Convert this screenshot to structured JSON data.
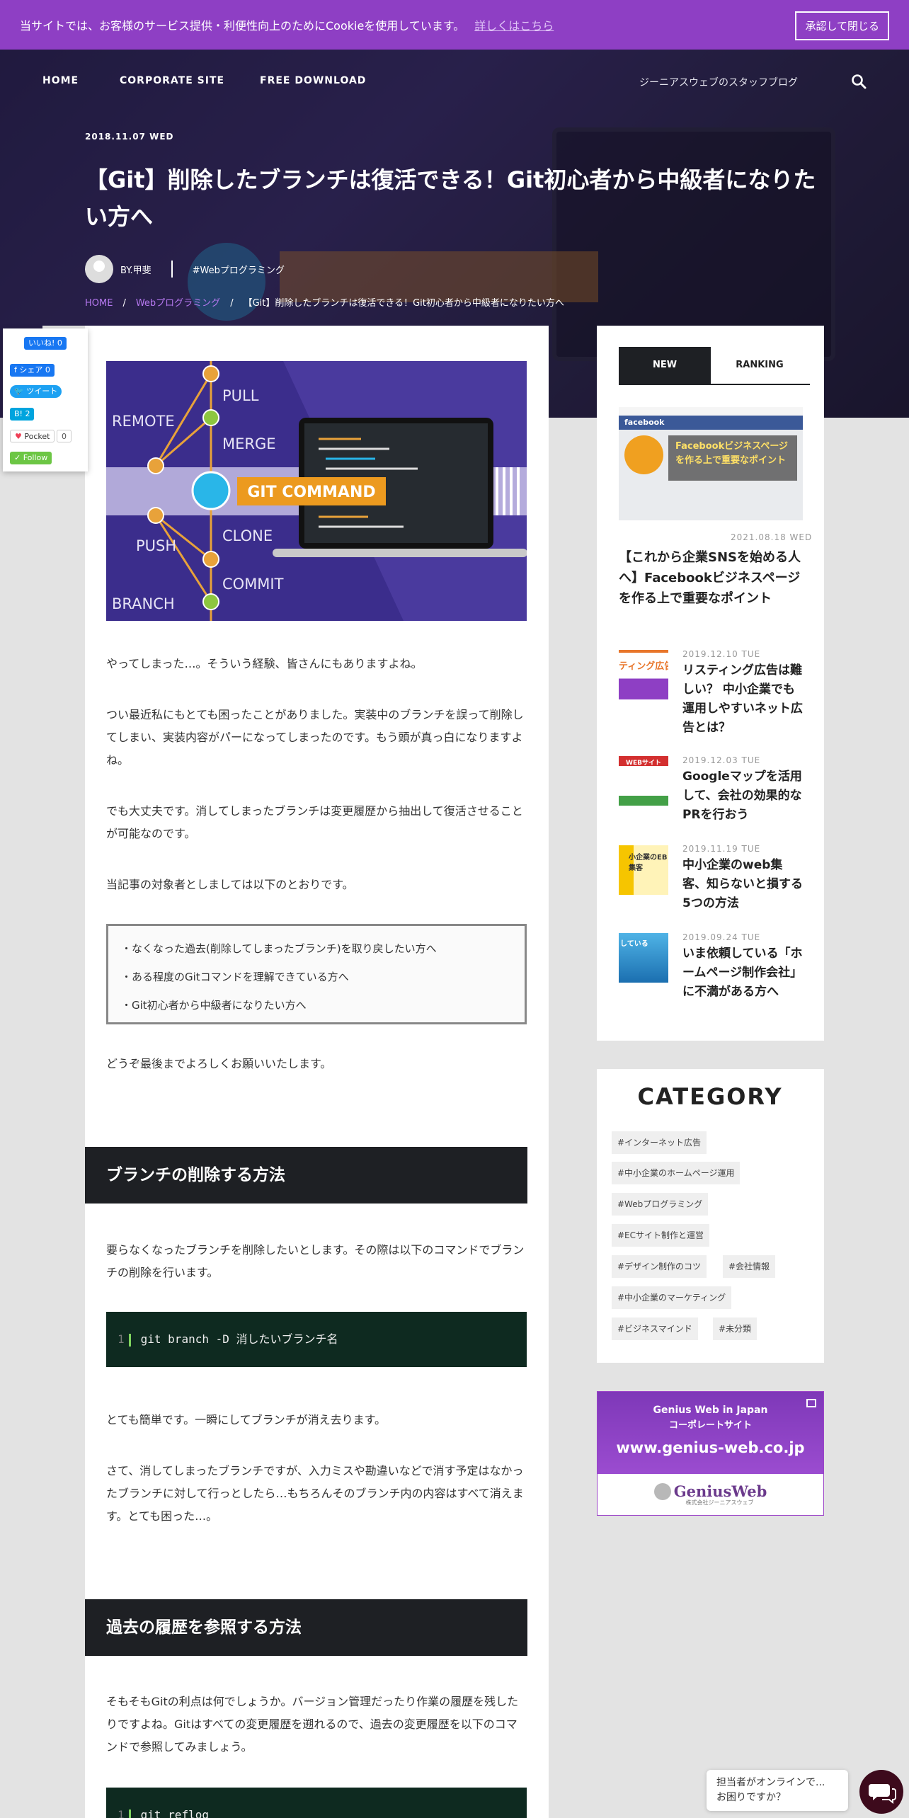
{
  "cookie": {
    "message": "当サイトでは、お客様のサービス提供・利便性向上のためにCookieを使用しています。",
    "more_link": "詳しくはこちら",
    "accept_button": "承認して閉じる"
  },
  "nav": {
    "items": [
      "HOME",
      "CORPORATE SITE",
      "FREE DOWNLOAD"
    ],
    "staff_blog": "ジーニアスウェブのスタッフブログ"
  },
  "article": {
    "date": "2018.11.07 WED",
    "title": "【Git】削除したブランチは復活できる！Git初心者から中級者になりたい方へ",
    "author": "BY.甲斐",
    "tag": "#Webプログラミング",
    "breadcrumb": [
      "HOME",
      "Webプログラミング",
      "【Git】削除したブランチは復活できる！Git初心者から中級者になりたい方へ"
    ],
    "hero_labels": {
      "remote": "REMOTE",
      "push": "PUSH",
      "branch": "BRANCH",
      "pull": "PULL",
      "merge": "MERGE",
      "clone": "CLONE",
      "commit": "COMMIT",
      "badge": "GIT COMMAND"
    },
    "p1": "やってしまった…。そういう経験、皆さんにもありますよね。",
    "p2": "つい最近私にもとても困ったことがありました。実装中のブランチを誤って削除してしまい、実装内容がパーになってしまったのです。もう頭が真っ白になりますよね。",
    "p3": "でも大丈夫です。消してしまったブランチは変更履歴から抽出して復活させることが可能なのです。",
    "p4": "当記事の対象者としましては以下のとおりです。",
    "targets": [
      "・なくなった過去(削除してしまったブランチ)を取り戻したい方へ",
      "・ある程度のGitコマンドを理解できている方へ",
      "・Git初心者から中級者になりたい方へ"
    ],
    "p5": "どうぞ最後までよろしくお願いいたします。",
    "h2_1": "ブランチの削除する方法",
    "p6": "要らなくなったブランチを削除したいとします。その際は以下のコマンドでブランチの削除を行います。",
    "code1": "git branch -D 消したいブランチ名",
    "p7": "とても簡単です。一瞬にしてブランチが消え去ります。",
    "p8": "さて、消してしまったブランチですが、入力ミスや勘違いなどで消す予定はなかったブランチに対して行っとしたら…もちろんそのブランチ内の内容はすべて消えます。とても困った…。",
    "h2_2": "過去の履歴を参照する方法",
    "p9": "そもそもGitの利点は何でしょうか。バージョン管理だったり作業の履歴を残したりですよね。Gitはすべての変更履歴を遡れるので、過去の変更履歴を以下のコマンドで参照してみましょう。",
    "code2": "git reflog",
    "line_no": "1"
  },
  "share": {
    "like": "いいね! 0",
    "fb_share": "シェア 0",
    "tweet": "ツイート",
    "hatena": "2",
    "pocket": "Pocket",
    "pocket_count": "0",
    "follow": "Follow"
  },
  "sidebar": {
    "tabs": [
      "NEW",
      "RANKING"
    ],
    "featured": {
      "date": "2021.08.18 WED",
      "title": "【これから企業SNSを始める人へ】Facebookビジネスページを作る上で重要なポイント",
      "thumb_text": "Facebookビジネスページを作る上で重要なポイント",
      "thumb_logo": "facebook"
    },
    "posts": [
      {
        "date": "2019.12.10 TUE",
        "title": "リスティング広告は難しい？ 中小企業でも運用しやすいネット広告とは？",
        "thumb": "ティング広告い?"
      },
      {
        "date": "2019.12.03 TUE",
        "title": "Googleマップを活用して、会社の効果的なPRを行おう",
        "thumb": "WEBサイト"
      },
      {
        "date": "2019.11.19 TUE",
        "title": "中小企業のweb集客、知らないと損する5つの方法",
        "thumb": "小企業のEB集客"
      },
      {
        "date": "2019.09.24 TUE",
        "title": "いま依頼している「ホームページ制作会社」に不満がある方へ",
        "thumb": "している"
      }
    ],
    "category_title": "CATEGORY",
    "categories": [
      "#インターネット広告",
      "#中小企業のホームページ運用",
      "#Webプログラミング",
      "#ECサイト制作と運営",
      "#デザイン制作のコツ",
      "#会社情報",
      "#中小企業のマーケティング",
      "#ビジネスマインド",
      "#未分類"
    ],
    "banner": {
      "line1": "Genius Web in Japan",
      "line2": "コーポレートサイト",
      "url": "www.genius-web.co.jp",
      "logo": "GeniusWeb",
      "logo_sub": "株式会社ジーニアスウェブ"
    }
  },
  "chat": {
    "line1": "担当者がオンラインで...",
    "line2": "お困りですか？"
  },
  "colors": {
    "cookie_bar": "#8e3fc4",
    "heading_bg": "#1e2024",
    "code_bg": "#0e2a20",
    "accent_purple": "#b678f0"
  }
}
